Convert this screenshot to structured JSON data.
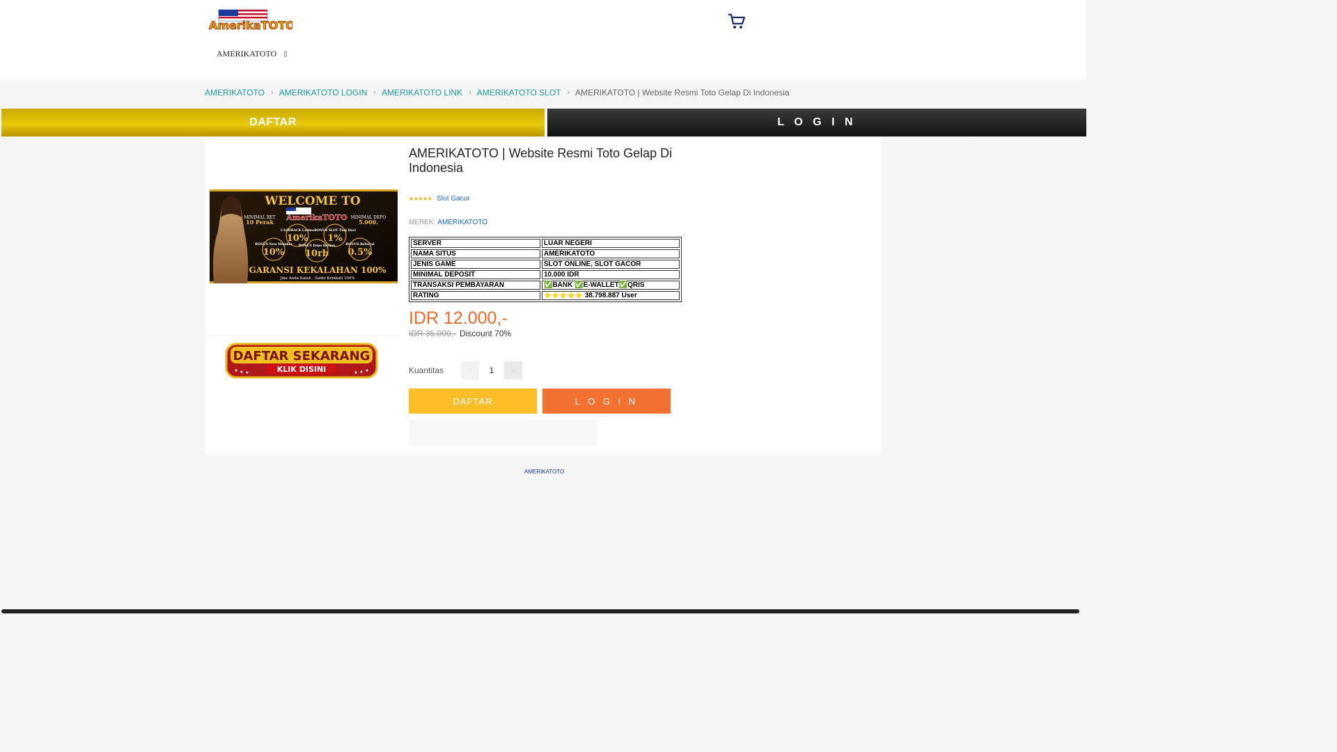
{
  "header": {
    "logo_text": "AmerikaTOTO",
    "nav_label": "AMERIKATOTO",
    "icons": {
      "cart": "cart-icon",
      "caret": "caret-down-icon"
    }
  },
  "breadcrumb": {
    "items": [
      "AMERIKATOTO",
      "AMERIKATOTO LOGIN",
      "AMERIKATOTO LINK",
      "AMERIKATOTO SLOT"
    ],
    "current": "AMERIKATOTO | Website Resmi Toto Gelap Di Indonesia"
  },
  "topbar": {
    "daftar": "DAFTAR",
    "login": "L O G I N"
  },
  "banner": {
    "welcome": "WELCOME TO",
    "brand": "AmerikaTOTO",
    "min_bet_label": "MINIMAL BET",
    "min_bet_value": "10 Perak",
    "min_depo_label": "MINIMAL DEPO",
    "min_depo_value": "5.000.",
    "cashback_label": "CASHBACK Casino",
    "cashback_value": "10%",
    "bonus_slot_label": "BONUS SLOT Tiap Hari",
    "bonus_slot_value": "1%",
    "bonus_member_label": "BONUS New Member",
    "bonus_member_value": "10%",
    "bonus_depo_label": "BONUS Depo Harian",
    "bonus_depo_value": "10rb",
    "bonus_ref_label": "BONUS Referral",
    "bonus_ref_value": "0.5%",
    "guarantee": "GARANSI KEKALAHAN 100%",
    "guarantee_sub": "Jika Anda Kalah , Saldo Kembali 100%"
  },
  "register_banner": {
    "title": "DAFTAR SEKARANG",
    "sub": "KLIK DISINI"
  },
  "product": {
    "title": "AMERIKATOTO | Website Resmi Toto Gelap Di Indonesia",
    "rating_stars": "★★★★★",
    "rating_tag": "Slot Gacor",
    "brand_label": "MEREK:",
    "brand_value": "AMERIKATOTO",
    "specs": [
      {
        "key": "SERVER",
        "value": "LUAR NEGERI"
      },
      {
        "key": "NAMA SITUS",
        "value": "AMERIKATOTO"
      },
      {
        "key": "JENIS GAME",
        "value": "SLOT ONLINE, SLOT GACOR"
      },
      {
        "key": "MINIMAL DEPOSIT",
        "value": "10.000 IDR"
      },
      {
        "key": "TRANSAKSI PEMBAYARAN",
        "value": "✅BANK ✅E-WALLET✅QRIS"
      },
      {
        "key": "RATING",
        "value": "38.798.887 User",
        "stars": "⭐⭐⭐⭐⭐"
      }
    ],
    "price": "IDR 12.000,-",
    "old_price": "IDR 35.000,-",
    "discount": "Discount 70%",
    "quantity_label": "Kuantitas",
    "quantity": "1",
    "btn_daftar": "DAFTAR",
    "btn_login": "L O G I N"
  },
  "footer": {
    "text": "AMERIKATOTO"
  },
  "colors": {
    "accent_teal": "#1a9aa0",
    "price_orange": "#ee6a2a",
    "daftar_yellow": "#fbbd28",
    "login_orange": "#f47230",
    "gold_bar": "#e8c90a"
  }
}
